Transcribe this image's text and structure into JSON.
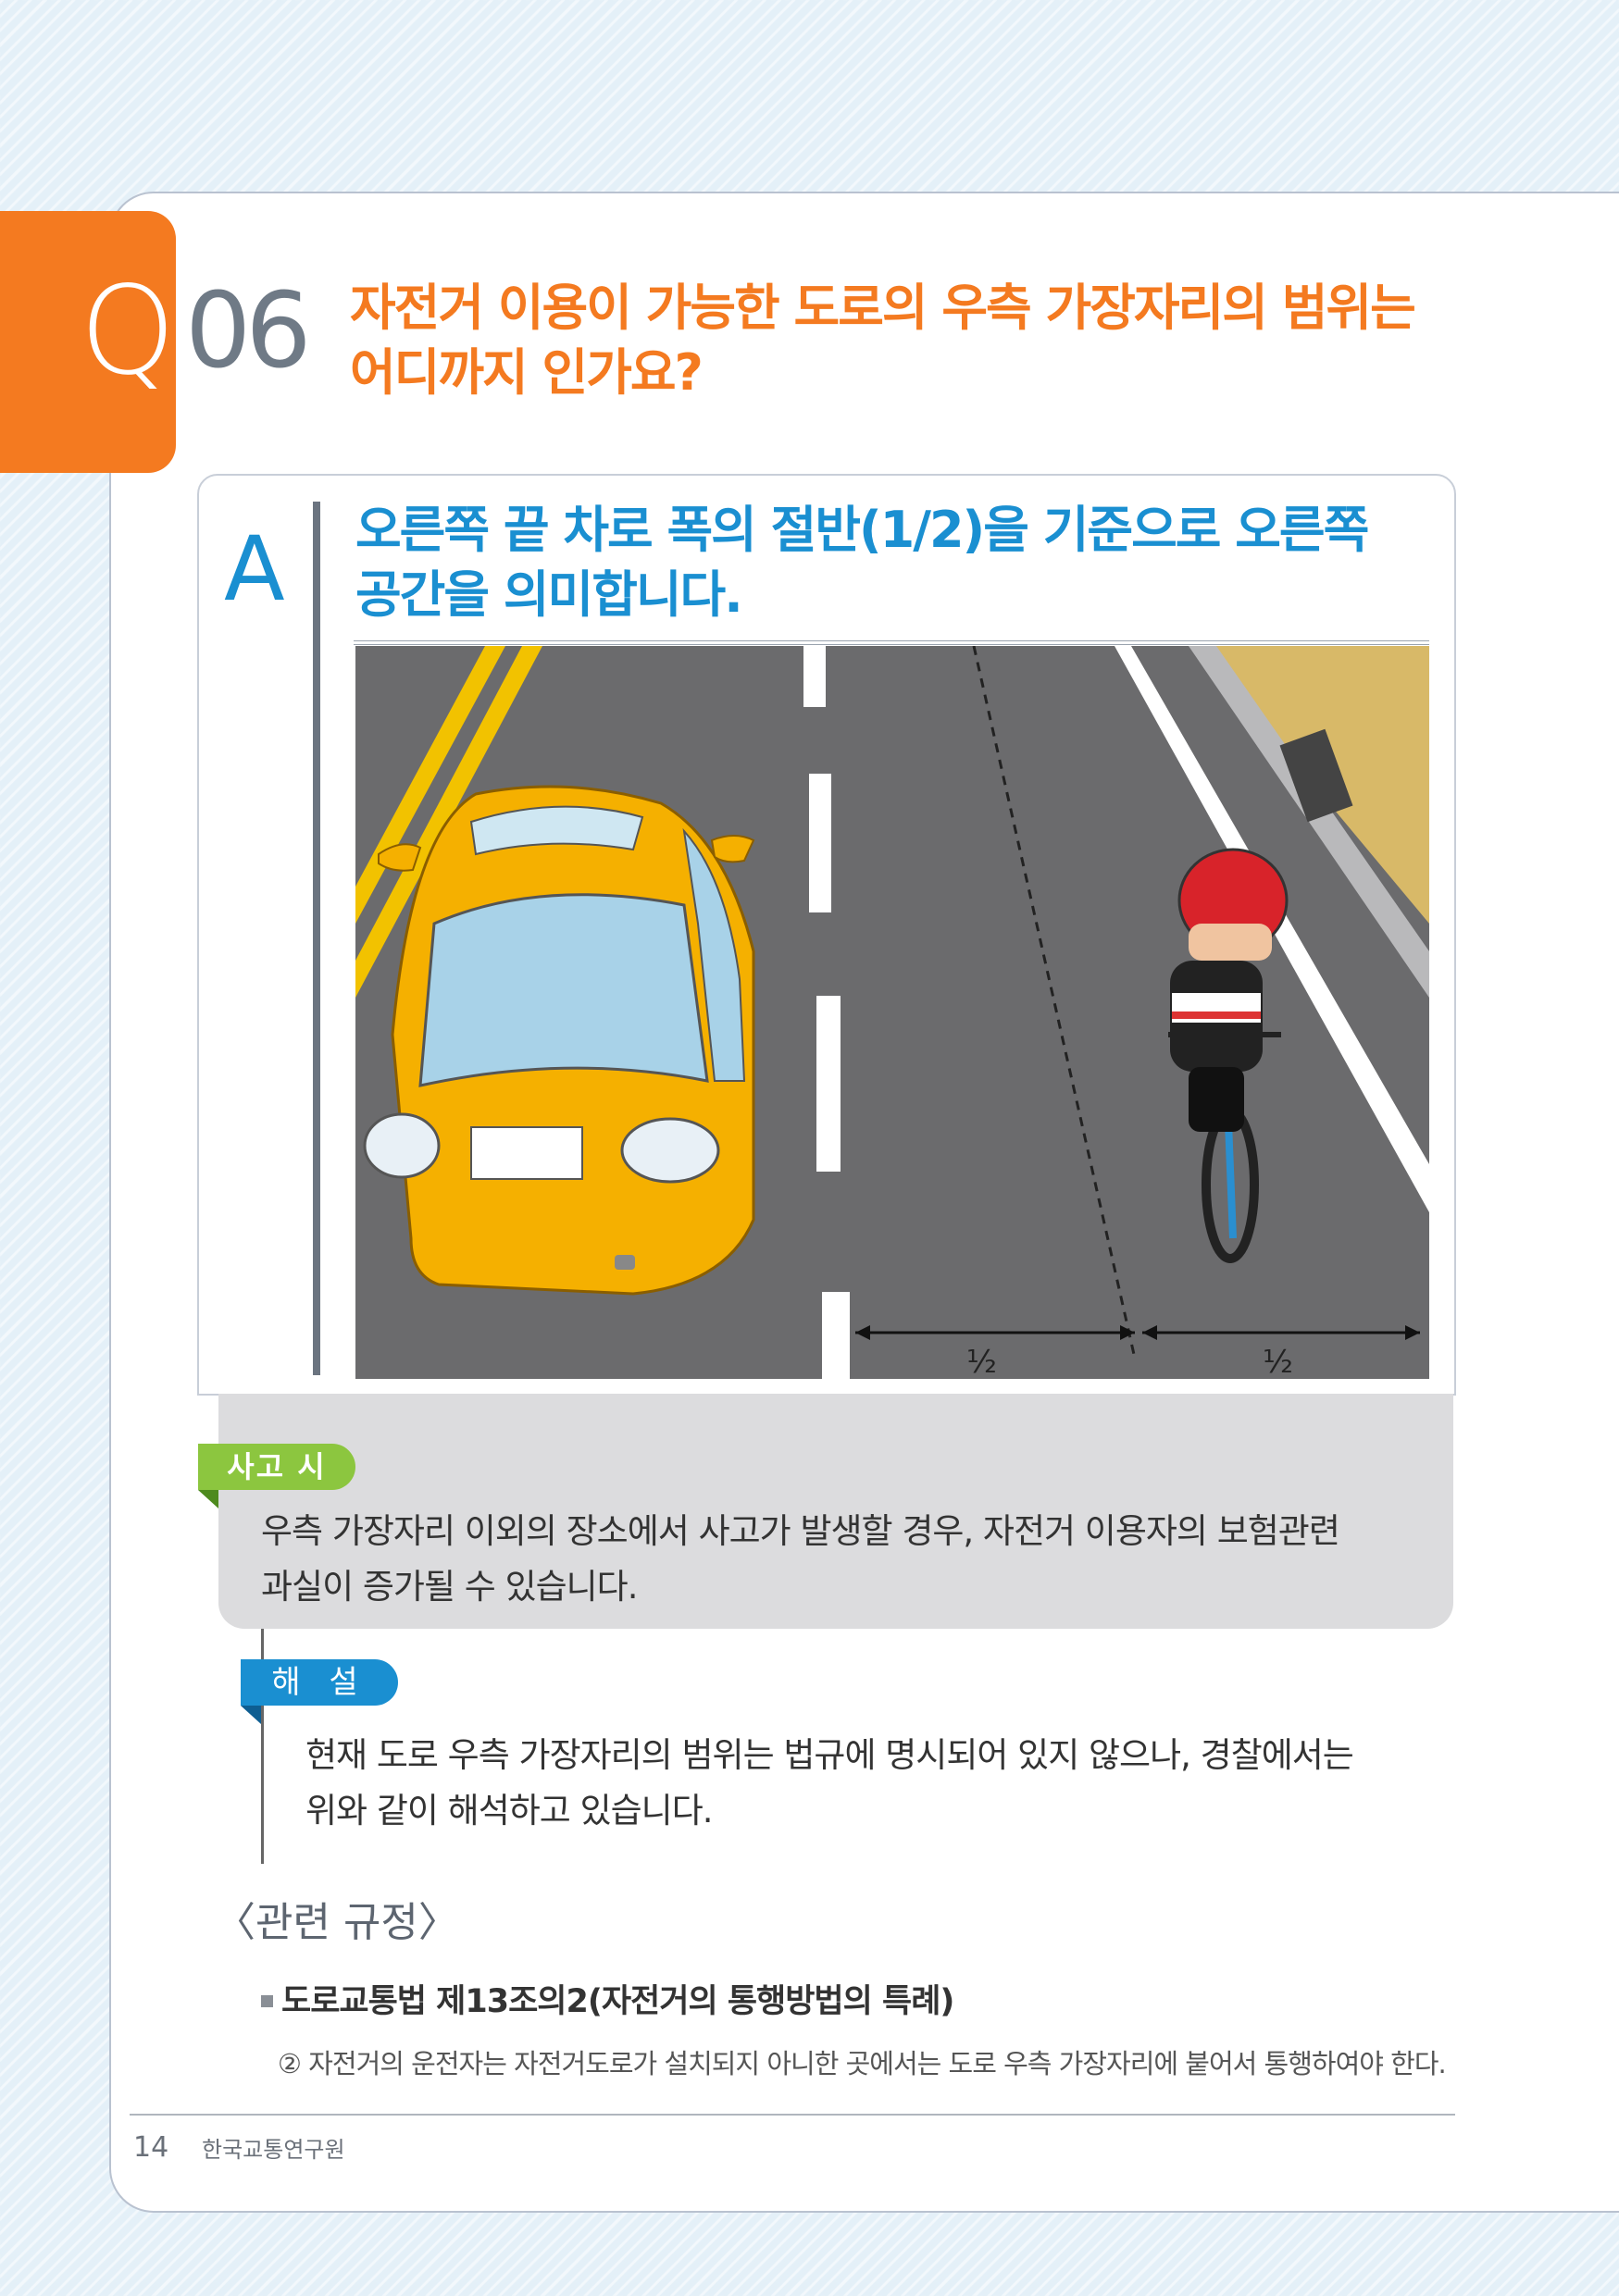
{
  "question": {
    "letter": "Q",
    "number": "06",
    "title_line1": "자전거 이용이 가능한 도로의 우측 가장자리의 범위는",
    "title_line2": "어디까지 인가요?"
  },
  "answer": {
    "letter": "A",
    "text_line1": "오른쪽 끝 차로 폭의 절반(1/2)을 기준으로 오른쪽",
    "text_line2": "공간을 의미합니다.",
    "illustration": {
      "left_half_label": "½",
      "right_half_label": "½"
    }
  },
  "accident": {
    "badge": "사고 시",
    "line1": "우측 가장자리 이외의 장소에서 사고가 발생할 경우, 자전거 이용자의 보험관련",
    "line2": "과실이 증가될 수 있습니다."
  },
  "explanation": {
    "badge": "해 설",
    "line1": "현재 도로 우측 가장자리의 범위는 법규에 명시되어 있지 않으나, 경찰에서는",
    "line2": "위와 같이 해석하고 있습니다."
  },
  "related": {
    "title": "〈관련 규정〉",
    "law_title": "도로교통법 제13조의2(자전거의 통행방법의 특례)",
    "law_text": "② 자전거의 운전자는 자전거도로가 설치되지 아니한 곳에서는 도로 우측 가장자리에 붙어서 통행하여야 한다."
  },
  "footer": {
    "page": "14",
    "org": "한국교통연구원"
  },
  "colors": {
    "orange": "#f47a20",
    "blue": "#1a8fd1",
    "green": "#8cc63f",
    "taxi_yellow": "#f5b000",
    "road_gray": "#6b6b6d"
  }
}
